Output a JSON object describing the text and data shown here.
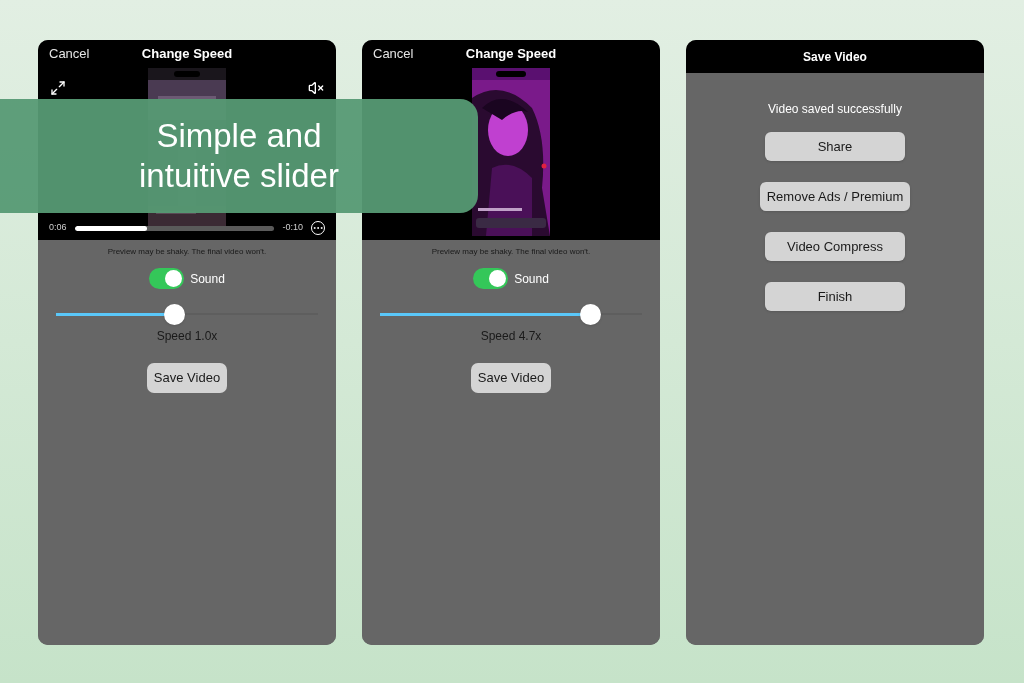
{
  "banner": {
    "lines": [
      "Simple and",
      "intuitive slider"
    ]
  },
  "screens": [
    {
      "kind": "speed",
      "cancel": "Cancel",
      "title": "Change Speed",
      "playback": {
        "elapsed": "0:06",
        "remaining": "-0:10",
        "level": 0.36
      },
      "notice": "Preview may be shaky. The final video won't.",
      "sound": {
        "label": "Sound",
        "on": true
      },
      "speed": {
        "level": 0.45,
        "label": "Speed 1.0x"
      },
      "save_button": "Save Video"
    },
    {
      "kind": "speed",
      "cancel": "Cancel",
      "title": "Change Speed",
      "notice": "Preview may be shaky. The final video won't.",
      "sound": {
        "label": "Sound",
        "on": true
      },
      "speed": {
        "level": 0.8,
        "label": "Speed 4.7x"
      },
      "save_button": "Save Video"
    },
    {
      "kind": "saved",
      "title": "Save Video",
      "message": "Video saved successfully",
      "buttons": [
        "Share",
        "Remove Ads / Premium",
        "Video Compress",
        "Finish"
      ]
    }
  ]
}
